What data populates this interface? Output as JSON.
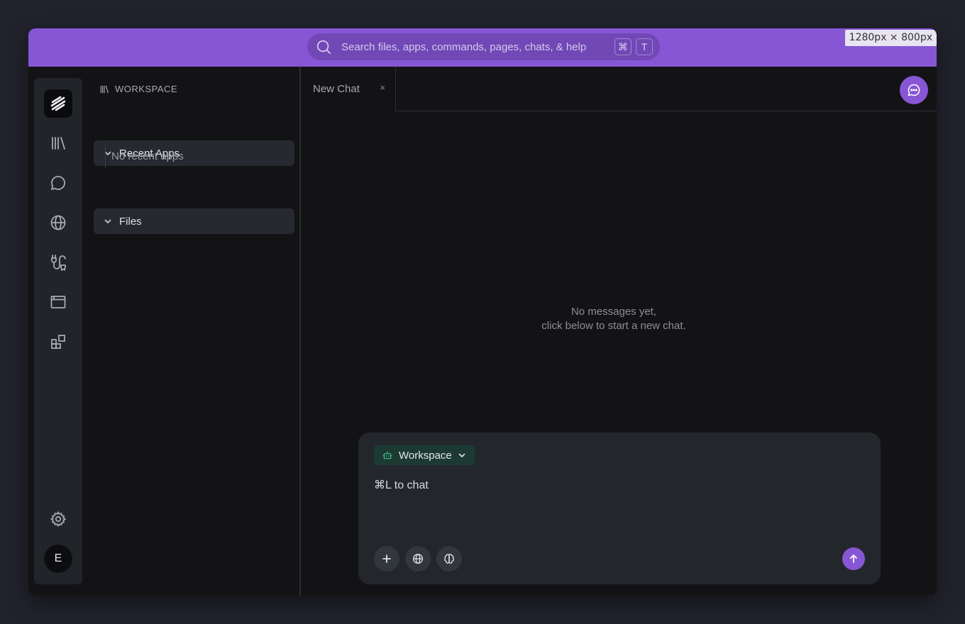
{
  "search": {
    "placeholder": "Search files, apps, commands, pages, chats, & help",
    "shortcut_keys": [
      "⌘",
      "T"
    ]
  },
  "viewport_badge": "1280px × 800px",
  "rail": {
    "icons": [
      "logo-icon",
      "library-icon",
      "chat-icon",
      "globe-icon",
      "plug-icon",
      "browser-window-icon",
      "widgets-icon",
      "settings-icon"
    ],
    "avatar_letter": "E"
  },
  "workspace": {
    "header": "WORKSPACE",
    "recent_apps_label": "Recent Apps",
    "recent_apps_empty": "No recent apps",
    "files_label": "Files"
  },
  "tabs": [
    {
      "label": "New Chat",
      "close": "×"
    }
  ],
  "chat": {
    "empty_line1": "No messages yet,",
    "empty_line2": "click below to start a new chat.",
    "mode_label": "Workspace",
    "prompt_placeholder": "⌘L to chat"
  },
  "colors": {
    "accent": "#8756d4",
    "background": "#131316",
    "mode_badge": "#1c3a32"
  }
}
